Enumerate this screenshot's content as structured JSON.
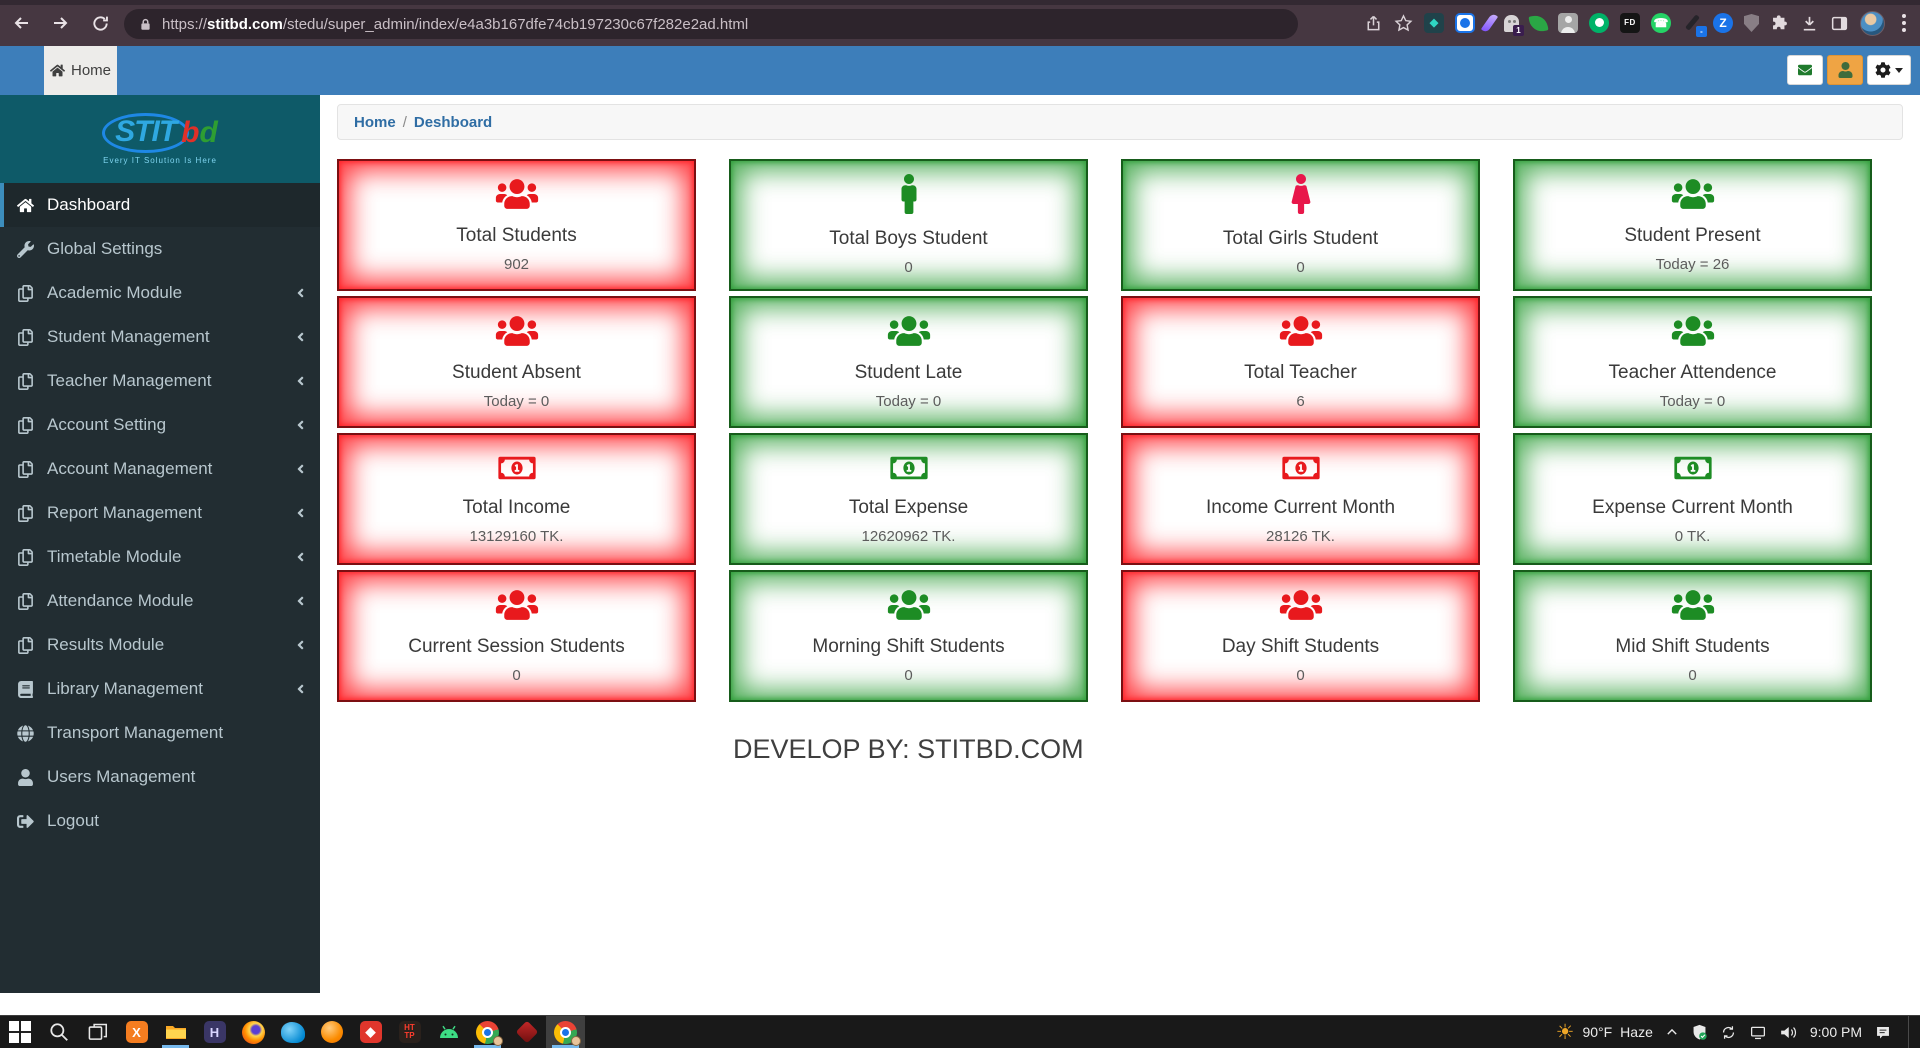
{
  "palette": {
    "red": "#e8191d",
    "green": "#1d8c24",
    "header_blue": "#3d7eba",
    "sidebar_dark": "#222d32",
    "sidebar_teal": "#0e5a68"
  },
  "browser": {
    "url_scheme": "https://",
    "url_domain": "stitbd.com",
    "url_path": "/stedu/super_admin/index/e4a3b167dfe74cb197230c67f282e2ad.html",
    "extensions": [
      {
        "name": "diamond-extension",
        "shape": "sq",
        "bg": "#20424a",
        "fg": "#2fd6c3",
        "glyph": "◆"
      },
      {
        "name": "record-extension",
        "shape": "ring"
      },
      {
        "name": "feather-extension",
        "shape": "feather"
      },
      {
        "name": "ghost-extension",
        "shape": "ghost",
        "badge": "1"
      },
      {
        "name": "green-leaf-extension",
        "shape": "leaf"
      },
      {
        "name": "person-extension",
        "shape": "personbox"
      },
      {
        "name": "green-circle-extension",
        "shape": "greenball"
      },
      {
        "name": "fd-extension",
        "shape": "sq",
        "small": true,
        "bg": "#151515",
        "fg": "#ffffff",
        "glyph": "FD"
      },
      {
        "name": "whatsapp-extension",
        "shape": "waball",
        "glyph": "☎"
      },
      {
        "name": "color-picker-extension",
        "shape": "dropper",
        "badge": "-"
      },
      {
        "name": "z-extension",
        "shape": "ball",
        "bg": "#1a73e8",
        "fg": "#ffffff",
        "glyph": "Z"
      },
      {
        "name": "shield-extension",
        "shape": "shieldgray"
      }
    ]
  },
  "app_header": {
    "home_tab": "Home"
  },
  "sidebar": {
    "logo_main": "STIT",
    "logo_b": "b",
    "logo_d": "d",
    "tagline": "Every IT Solution Is Here",
    "items": [
      {
        "id": "dashboard",
        "label": "Dashboard",
        "icon": "home",
        "active": true
      },
      {
        "id": "global-settings",
        "label": "Global Settings",
        "icon": "wrench"
      },
      {
        "id": "academic-module",
        "label": "Academic Module",
        "icon": "copy",
        "chevron": true
      },
      {
        "id": "student-management",
        "label": "Student Management",
        "icon": "copy",
        "chevron": true
      },
      {
        "id": "teacher-management",
        "label": "Teacher Management",
        "icon": "copy",
        "chevron": true
      },
      {
        "id": "account-setting",
        "label": "Account Setting",
        "icon": "copy",
        "chevron": true
      },
      {
        "id": "account-management",
        "label": "Account Management",
        "icon": "copy",
        "chevron": true
      },
      {
        "id": "report-management",
        "label": "Report Management",
        "icon": "copy",
        "chevron": true
      },
      {
        "id": "timetable-module",
        "label": "Timetable Module",
        "icon": "copy",
        "chevron": true
      },
      {
        "id": "attendance-module",
        "label": "Attendance Module",
        "icon": "copy",
        "chevron": true
      },
      {
        "id": "results-module",
        "label": "Results Module",
        "icon": "copy",
        "chevron": true
      },
      {
        "id": "library-management",
        "label": "Library Management",
        "icon": "book",
        "chevron": true
      },
      {
        "id": "transport-management",
        "label": "Transport Management",
        "icon": "globe"
      },
      {
        "id": "users-management",
        "label": "Users Management",
        "icon": "user"
      },
      {
        "id": "logout",
        "label": "Logout",
        "icon": "signout"
      }
    ]
  },
  "breadcrumb": {
    "home": "Home",
    "sep": "/",
    "current": "Deshboard"
  },
  "cards": [
    {
      "title": "Total Students",
      "value": "902",
      "icon": "users",
      "color": "red"
    },
    {
      "title": "Total Boys Student",
      "value": "0",
      "icon": "male",
      "color": "green"
    },
    {
      "title": "Total Girls Student",
      "value": "0",
      "icon": "female",
      "color": "green",
      "icon_color": "#e8174a"
    },
    {
      "title": "Student Present",
      "value": "Today = 26",
      "icon": "users",
      "color": "green"
    },
    {
      "title": "Student Absent",
      "value": "Today = 0",
      "icon": "users",
      "color": "red"
    },
    {
      "title": "Student Late",
      "value": "Today = 0",
      "icon": "users",
      "color": "green"
    },
    {
      "title": "Total Teacher",
      "value": "6",
      "icon": "users",
      "color": "red"
    },
    {
      "title": "Teacher Attendence",
      "value": "Today = 0",
      "icon": "users",
      "color": "green"
    },
    {
      "title": "Total Income",
      "value": "13129160 TK.",
      "icon": "money",
      "color": "red"
    },
    {
      "title": "Total Expense",
      "value": "12620962 TK.",
      "icon": "money",
      "color": "green"
    },
    {
      "title": "Income Current Month",
      "value": "28126 TK.",
      "icon": "money",
      "color": "red"
    },
    {
      "title": "Expense Current Month",
      "value": "0 TK.",
      "icon": "money",
      "color": "green"
    },
    {
      "title": "Current Session Students",
      "value": "0",
      "icon": "users",
      "color": "red"
    },
    {
      "title": "Morning Shift Students",
      "value": "0",
      "icon": "users",
      "color": "green"
    },
    {
      "title": "Day Shift Students",
      "value": "0",
      "icon": "users",
      "color": "red"
    },
    {
      "title": "Mid Shift Students",
      "value": "0",
      "icon": "users",
      "color": "green"
    }
  ],
  "footer_note": "DEVELOP BY: STITBD.COM",
  "taskbar": {
    "items": [
      {
        "name": "start-button",
        "shape": "windows"
      },
      {
        "name": "search-button",
        "shape": "magnifier"
      },
      {
        "name": "task-view-button",
        "shape": "taskview"
      },
      {
        "name": "xampp-icon",
        "shape": "sq",
        "bg": "#f57d20",
        "fg": "#ffffff",
        "glyph": "X"
      },
      {
        "name": "file-explorer-icon",
        "shape": "folder",
        "open": true
      },
      {
        "name": "editor-h-icon",
        "shape": "sq",
        "bg": "#3a3666",
        "fg": "#d9d5ff",
        "glyph": "H"
      },
      {
        "name": "firefox-icon",
        "shape": "firefox"
      },
      {
        "name": "mysql-workbench-icon",
        "shape": "dolphin"
      },
      {
        "name": "orange-app-icon",
        "shape": "orangeball"
      },
      {
        "name": "red-app-icon",
        "shape": "sq",
        "bg": "#e0362c",
        "fg": "#ffffff",
        "glyph": "◆"
      },
      {
        "name": "http-tool-icon",
        "shape": "sq",
        "small": true,
        "bg": "#2a211c",
        "fg": "#ff3d2e",
        "glyph": "HT\nTP"
      },
      {
        "name": "android-studio-icon",
        "shape": "android"
      },
      {
        "name": "chrome-profile1-icon",
        "shape": "chrome",
        "open": true,
        "profile_badge": true
      },
      {
        "name": "ruby-app-icon",
        "shape": "gem"
      },
      {
        "name": "chrome-profile2-icon",
        "shape": "chrome",
        "open": true,
        "active": true,
        "profile_badge": true
      }
    ],
    "tray": {
      "weather_icon": "☀",
      "weather_temp": "90°F",
      "weather_cond": "Haze",
      "time": "9:00 PM"
    }
  }
}
